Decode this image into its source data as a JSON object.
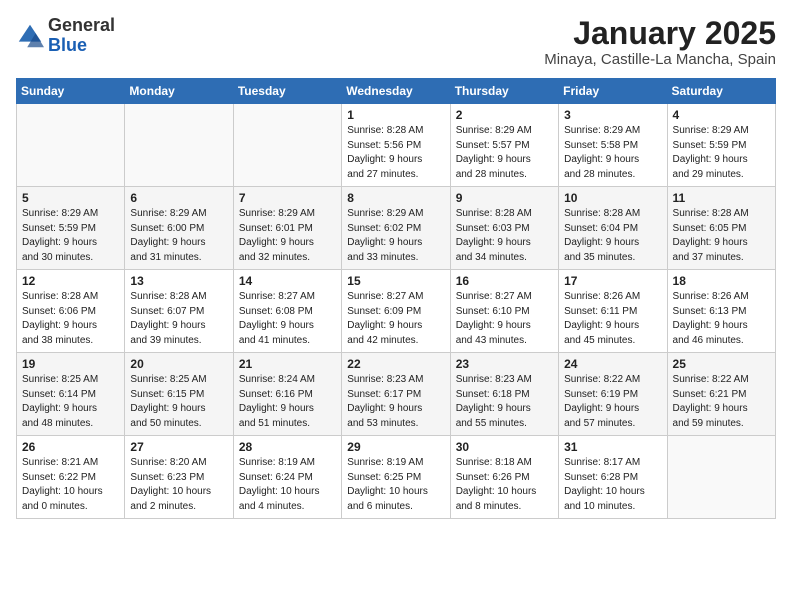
{
  "header": {
    "logo": {
      "general": "General",
      "blue": "Blue"
    },
    "title": "January 2025",
    "subtitle": "Minaya, Castille-La Mancha, Spain"
  },
  "calendar": {
    "columns": [
      "Sunday",
      "Monday",
      "Tuesday",
      "Wednesday",
      "Thursday",
      "Friday",
      "Saturday"
    ],
    "weeks": [
      [
        {
          "day": "",
          "info": ""
        },
        {
          "day": "",
          "info": ""
        },
        {
          "day": "",
          "info": ""
        },
        {
          "day": "1",
          "info": "Sunrise: 8:28 AM\nSunset: 5:56 PM\nDaylight: 9 hours\nand 27 minutes."
        },
        {
          "day": "2",
          "info": "Sunrise: 8:29 AM\nSunset: 5:57 PM\nDaylight: 9 hours\nand 28 minutes."
        },
        {
          "day": "3",
          "info": "Sunrise: 8:29 AM\nSunset: 5:58 PM\nDaylight: 9 hours\nand 28 minutes."
        },
        {
          "day": "4",
          "info": "Sunrise: 8:29 AM\nSunset: 5:59 PM\nDaylight: 9 hours\nand 29 minutes."
        }
      ],
      [
        {
          "day": "5",
          "info": "Sunrise: 8:29 AM\nSunset: 5:59 PM\nDaylight: 9 hours\nand 30 minutes."
        },
        {
          "day": "6",
          "info": "Sunrise: 8:29 AM\nSunset: 6:00 PM\nDaylight: 9 hours\nand 31 minutes."
        },
        {
          "day": "7",
          "info": "Sunrise: 8:29 AM\nSunset: 6:01 PM\nDaylight: 9 hours\nand 32 minutes."
        },
        {
          "day": "8",
          "info": "Sunrise: 8:29 AM\nSunset: 6:02 PM\nDaylight: 9 hours\nand 33 minutes."
        },
        {
          "day": "9",
          "info": "Sunrise: 8:28 AM\nSunset: 6:03 PM\nDaylight: 9 hours\nand 34 minutes."
        },
        {
          "day": "10",
          "info": "Sunrise: 8:28 AM\nSunset: 6:04 PM\nDaylight: 9 hours\nand 35 minutes."
        },
        {
          "day": "11",
          "info": "Sunrise: 8:28 AM\nSunset: 6:05 PM\nDaylight: 9 hours\nand 37 minutes."
        }
      ],
      [
        {
          "day": "12",
          "info": "Sunrise: 8:28 AM\nSunset: 6:06 PM\nDaylight: 9 hours\nand 38 minutes."
        },
        {
          "day": "13",
          "info": "Sunrise: 8:28 AM\nSunset: 6:07 PM\nDaylight: 9 hours\nand 39 minutes."
        },
        {
          "day": "14",
          "info": "Sunrise: 8:27 AM\nSunset: 6:08 PM\nDaylight: 9 hours\nand 41 minutes."
        },
        {
          "day": "15",
          "info": "Sunrise: 8:27 AM\nSunset: 6:09 PM\nDaylight: 9 hours\nand 42 minutes."
        },
        {
          "day": "16",
          "info": "Sunrise: 8:27 AM\nSunset: 6:10 PM\nDaylight: 9 hours\nand 43 minutes."
        },
        {
          "day": "17",
          "info": "Sunrise: 8:26 AM\nSunset: 6:11 PM\nDaylight: 9 hours\nand 45 minutes."
        },
        {
          "day": "18",
          "info": "Sunrise: 8:26 AM\nSunset: 6:13 PM\nDaylight: 9 hours\nand 46 minutes."
        }
      ],
      [
        {
          "day": "19",
          "info": "Sunrise: 8:25 AM\nSunset: 6:14 PM\nDaylight: 9 hours\nand 48 minutes."
        },
        {
          "day": "20",
          "info": "Sunrise: 8:25 AM\nSunset: 6:15 PM\nDaylight: 9 hours\nand 50 minutes."
        },
        {
          "day": "21",
          "info": "Sunrise: 8:24 AM\nSunset: 6:16 PM\nDaylight: 9 hours\nand 51 minutes."
        },
        {
          "day": "22",
          "info": "Sunrise: 8:23 AM\nSunset: 6:17 PM\nDaylight: 9 hours\nand 53 minutes."
        },
        {
          "day": "23",
          "info": "Sunrise: 8:23 AM\nSunset: 6:18 PM\nDaylight: 9 hours\nand 55 minutes."
        },
        {
          "day": "24",
          "info": "Sunrise: 8:22 AM\nSunset: 6:19 PM\nDaylight: 9 hours\nand 57 minutes."
        },
        {
          "day": "25",
          "info": "Sunrise: 8:22 AM\nSunset: 6:21 PM\nDaylight: 9 hours\nand 59 minutes."
        }
      ],
      [
        {
          "day": "26",
          "info": "Sunrise: 8:21 AM\nSunset: 6:22 PM\nDaylight: 10 hours\nand 0 minutes."
        },
        {
          "day": "27",
          "info": "Sunrise: 8:20 AM\nSunset: 6:23 PM\nDaylight: 10 hours\nand 2 minutes."
        },
        {
          "day": "28",
          "info": "Sunrise: 8:19 AM\nSunset: 6:24 PM\nDaylight: 10 hours\nand 4 minutes."
        },
        {
          "day": "29",
          "info": "Sunrise: 8:19 AM\nSunset: 6:25 PM\nDaylight: 10 hours\nand 6 minutes."
        },
        {
          "day": "30",
          "info": "Sunrise: 8:18 AM\nSunset: 6:26 PM\nDaylight: 10 hours\nand 8 minutes."
        },
        {
          "day": "31",
          "info": "Sunrise: 8:17 AM\nSunset: 6:28 PM\nDaylight: 10 hours\nand 10 minutes."
        },
        {
          "day": "",
          "info": ""
        }
      ]
    ]
  }
}
